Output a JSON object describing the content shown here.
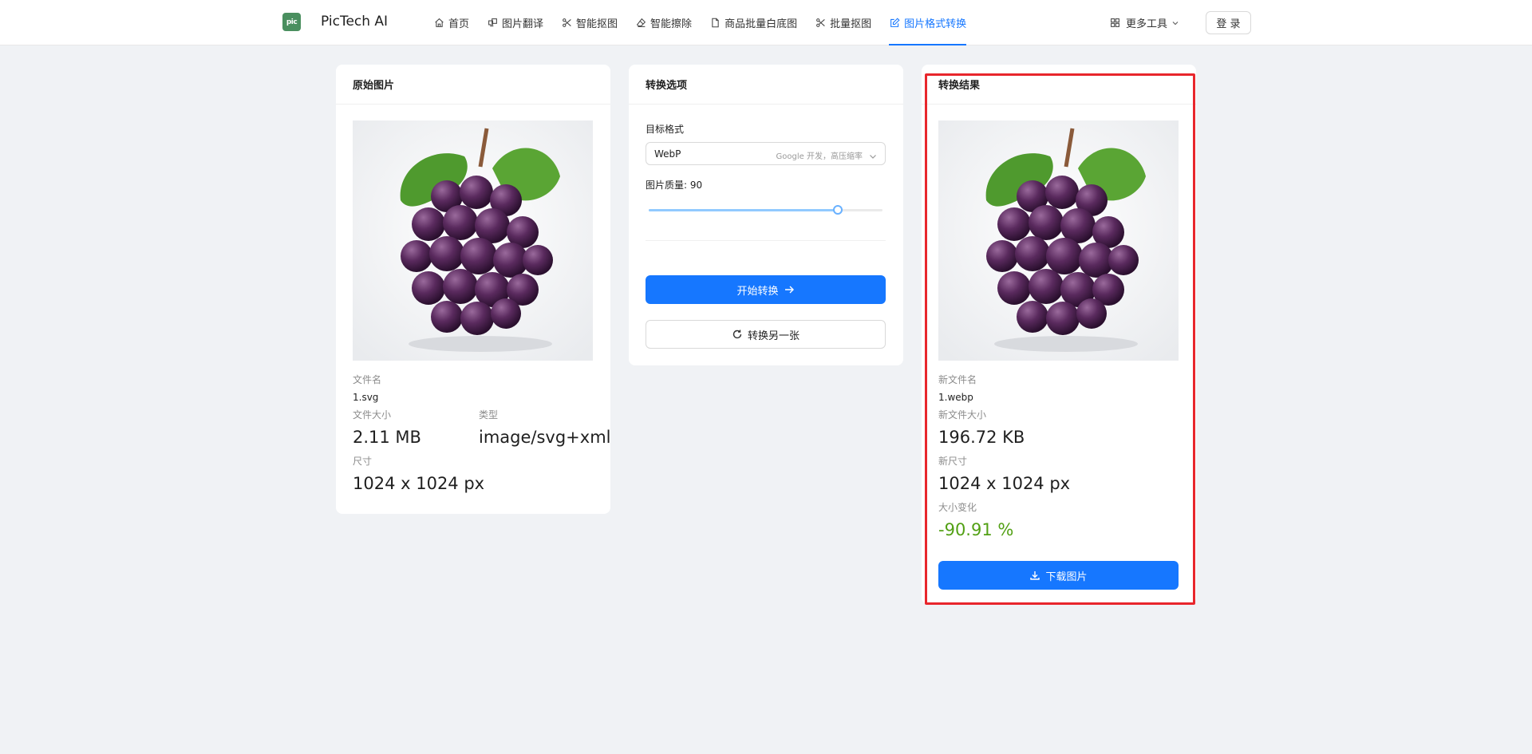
{
  "header": {
    "logo_text": "pic",
    "brand": "PicTech AI",
    "nav": [
      {
        "label": "首页",
        "icon": "home-icon"
      },
      {
        "label": "图片翻译",
        "icon": "translate-icon"
      },
      {
        "label": "智能抠图",
        "icon": "scissors-icon"
      },
      {
        "label": "智能擦除",
        "icon": "eraser-icon"
      },
      {
        "label": "商品批量白底图",
        "icon": "file-icon"
      },
      {
        "label": "批量抠图",
        "icon": "scissors-icon"
      },
      {
        "label": "图片格式转换",
        "icon": "edit-icon",
        "active": true
      }
    ],
    "more_tools": "更多工具",
    "login": "登 录"
  },
  "original": {
    "title": "原始图片",
    "filename_label": "文件名",
    "filename": "1.svg",
    "size_label": "文件大小",
    "size": "2.11 MB",
    "type_label": "类型",
    "type": "image/svg+xml",
    "dims_label": "尺寸",
    "dims": "1024 x 1024 px"
  },
  "options": {
    "title": "转换选项",
    "format_label": "目标格式",
    "format_value": "WebP",
    "format_desc": "Google 开发，高压缩率",
    "quality_label": "图片质量: 90",
    "quality_value": 90,
    "quality_max": 100,
    "convert_button": "开始转换",
    "another_button": "转换另一张"
  },
  "result": {
    "title": "转换结果",
    "filename_label": "新文件名",
    "filename": "1.webp",
    "size_label": "新文件大小",
    "size": "196.72 KB",
    "dims_label": "新尺寸",
    "dims": "1024 x 1024 px",
    "change_label": "大小变化",
    "change": "-90.91 %",
    "download_button": "下载图片"
  },
  "colors": {
    "accent": "#1677ff",
    "positive": "#52a014",
    "highlight": "#e8262c"
  }
}
